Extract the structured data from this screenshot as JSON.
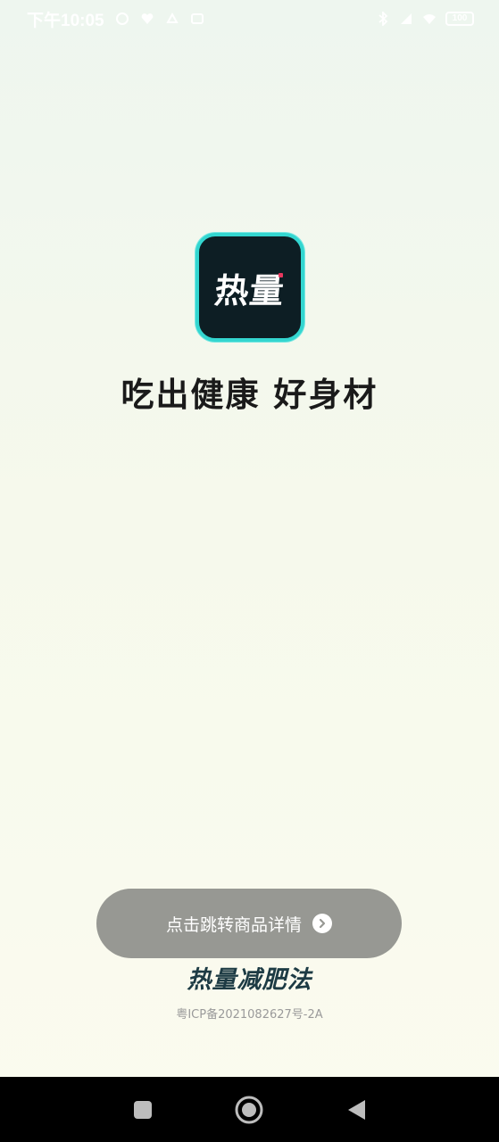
{
  "status_bar": {
    "time": "下午10:05",
    "battery": "100"
  },
  "logo": {
    "text": "热量"
  },
  "slogan": "吃出健康 好身材",
  "detail_button": {
    "label": "点击跳转商品详情"
  },
  "brand_name": "热量减肥法",
  "icp_text": "粤ICP备2021082627号-2A",
  "colors": {
    "logo_bg": "#0d1e24",
    "logo_border": "#33d6d0",
    "button_bg": "#979893",
    "brand_text": "#1d3b44"
  },
  "nav": {
    "icons": [
      "recent-apps-icon",
      "home-icon",
      "back-icon"
    ]
  }
}
